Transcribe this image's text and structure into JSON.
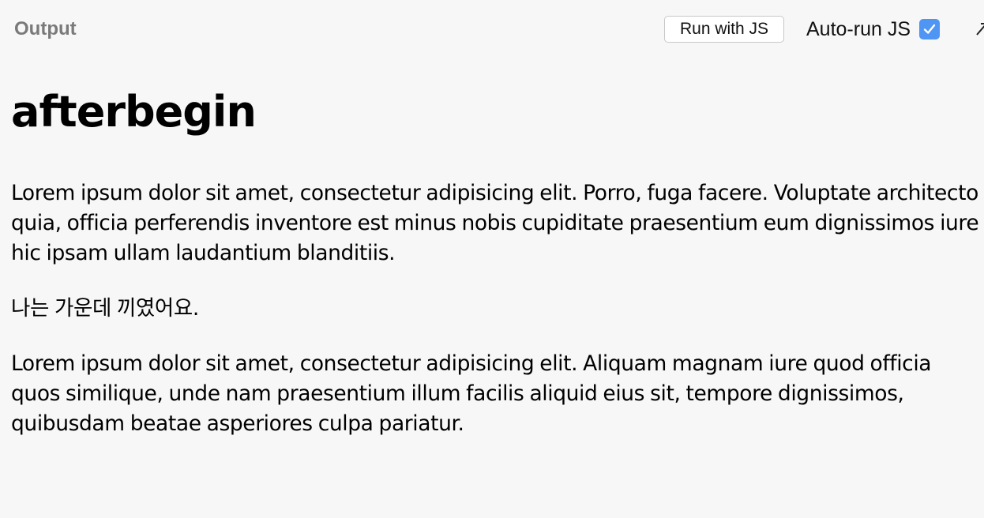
{
  "header": {
    "title": "Output",
    "run_button_label": "Run with JS",
    "autorun_label": "Auto-run JS",
    "autorun_checked": true,
    "accent_color": "#4f95f3"
  },
  "content": {
    "heading": "afterbegin",
    "paragraphs": [
      "Lorem ipsum dolor sit amet, consectetur adipisicing elit. Porro, fuga facere. Voluptate architecto quia, officia perferendis inventore est minus nobis cupiditate praesentium eum dignissimos iure hic ipsam ullam laudantium blanditiis.",
      "나는 가운데 끼였어요.",
      "Lorem ipsum dolor sit amet, consectetur adipisicing elit. Aliquam magnam iure quod officia quos similique, unde nam praesentium illum facilis aliquid eius sit, tempore dignissimos, quibusdam beatae asperiores culpa pariatur."
    ]
  },
  "icons": {
    "checkbox": "checkmark-icon",
    "expand": "expand-icon"
  }
}
